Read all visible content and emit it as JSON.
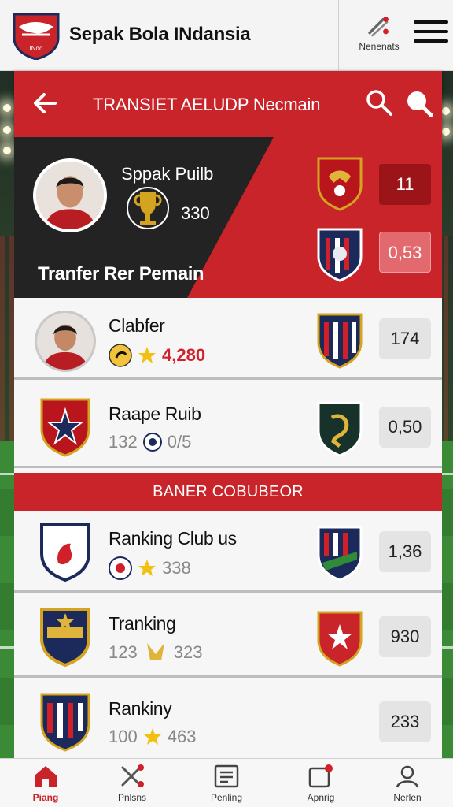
{
  "header": {
    "app_title": "Sepak Bola INdansia",
    "logo_text": "INdo",
    "notifications_label": "Nenenats"
  },
  "titlebar": {
    "title": "TRANSIET AELUDP Necmain"
  },
  "hero": {
    "player_name": "Sppak Puilb",
    "trophy_value": "330",
    "caption": "Tranfer Rer Pemain",
    "box_1": "11",
    "box_2": "0,53"
  },
  "rows": [
    {
      "title": "Clabfer",
      "meta_value": "4,280",
      "box": "174"
    },
    {
      "title": "Raape Ruib",
      "meta_value_1": "132",
      "meta_value_2": "0/5",
      "box": "0,50"
    },
    {
      "title": "Ranking Club us",
      "meta_value": "338",
      "box": "1,36"
    },
    {
      "title": "Tranking",
      "meta_value_1": "123",
      "meta_value_2": "323",
      "box": "930"
    },
    {
      "title": "Rankiny",
      "meta_value_1": "100",
      "meta_value_2": "463",
      "box": "233"
    }
  ],
  "banner": {
    "label": "BANER COBUBEOR"
  },
  "bottom_nav": [
    {
      "label": "Piang",
      "icon": "home-icon",
      "active": true
    },
    {
      "label": "Pnlsns",
      "icon": "whistle-icon"
    },
    {
      "label": "Penling",
      "icon": "list-icon"
    },
    {
      "label": "Apnrig",
      "icon": "notification-icon"
    },
    {
      "label": "Nerlen",
      "icon": "profile-icon"
    }
  ],
  "colors": {
    "accent": "#c8242a",
    "dark": "#232323",
    "panel": "#f6f6f6"
  }
}
